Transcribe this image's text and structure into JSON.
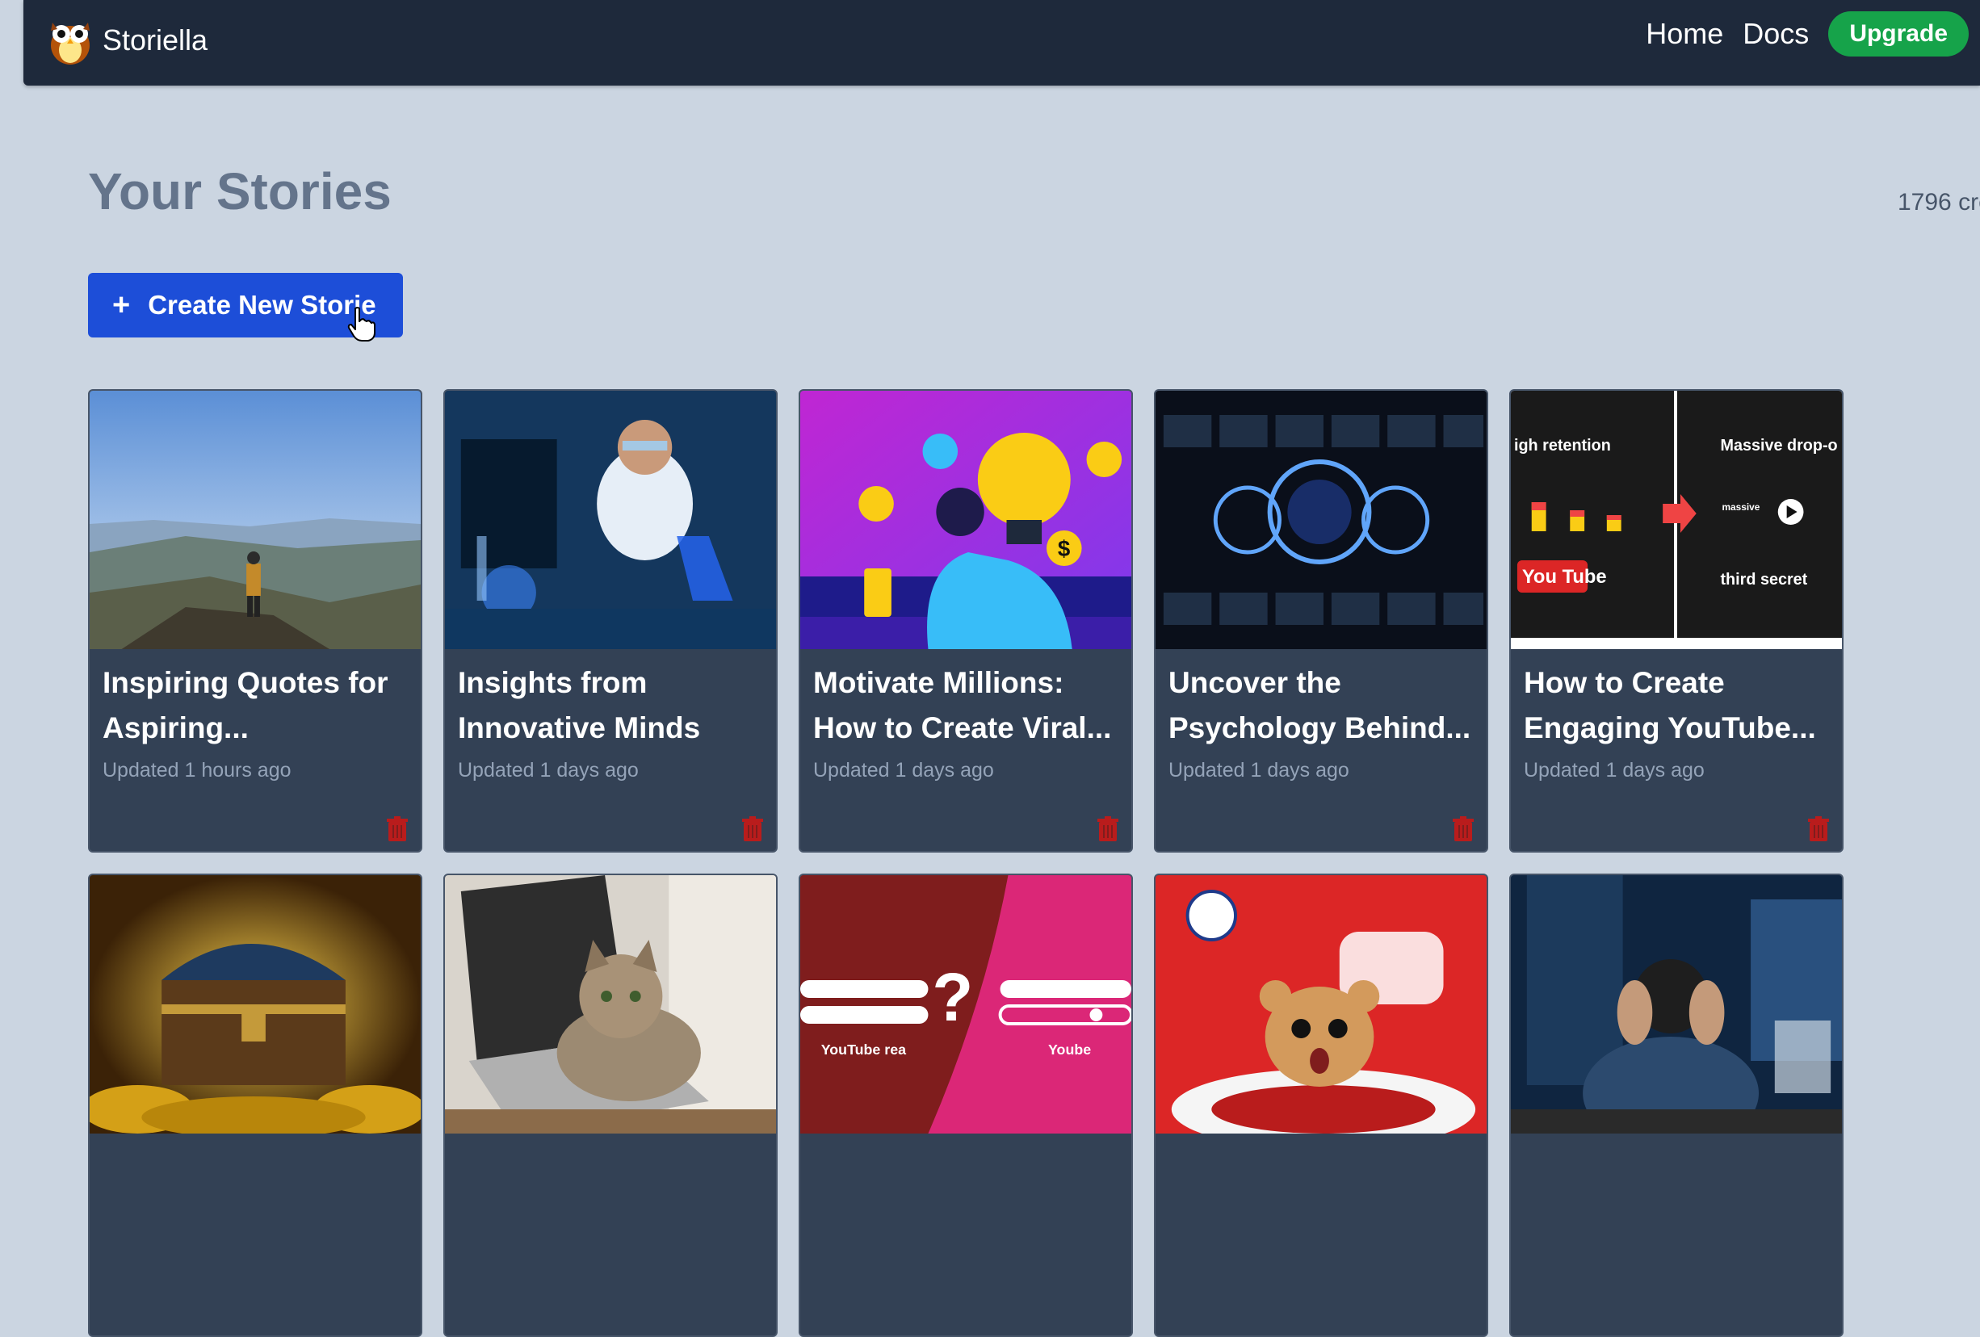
{
  "app": {
    "name": "Storiella"
  },
  "nav": {
    "home": "Home",
    "docs": "Docs",
    "upgrade": "Upgrade"
  },
  "page": {
    "title": "Your Stories",
    "credits": "1796 cre",
    "create_label": "Create New Storie",
    "create_icon": "+"
  },
  "stories": [
    {
      "title": "Inspiring Quotes for Aspiring...",
      "updated": "Updated 1 hours ago",
      "thumbnail": "mountain-hiker"
    },
    {
      "title": "Insights from Innovative Minds",
      "updated": "Updated 1 days ago",
      "thumbnail": "scientist-lab"
    },
    {
      "title": "Motivate Millions: How to Create Viral...",
      "updated": "Updated 1 days ago",
      "thumbnail": "idea-lightbulb"
    },
    {
      "title": "Uncover the Psychology Behind...",
      "updated": "Updated 1 days ago",
      "thumbnail": "virus-screens"
    },
    {
      "title": "How to Create Engaging YouTube...",
      "updated": "Updated 1 days ago",
      "thumbnail": "youtube-retention",
      "thumb_text": {
        "left_heading": "igh retention",
        "right_heading": "Massive drop-o",
        "youtube": "You Tube",
        "third": "third secret",
        "massive": "massive"
      }
    },
    {
      "title": "",
      "updated": "",
      "thumbnail": "treasure-chest"
    },
    {
      "title": "",
      "updated": "",
      "thumbnail": "cat-laptop"
    },
    {
      "title": "",
      "updated": "",
      "thumbnail": "youtube-question",
      "thumb_text": {
        "left_label": "YouTube rea",
        "right_label": "Yoube"
      }
    },
    {
      "title": "",
      "updated": "",
      "thumbnail": "hamster-youtube"
    },
    {
      "title": "",
      "updated": "",
      "thumbnail": "stressed-man"
    }
  ],
  "colors": {
    "navbar": "#1e293b",
    "background": "#cbd5e1",
    "card": "#334155",
    "primary": "#1d4ed8",
    "upgrade": "#16a34a",
    "trash": "#b91c1c"
  }
}
